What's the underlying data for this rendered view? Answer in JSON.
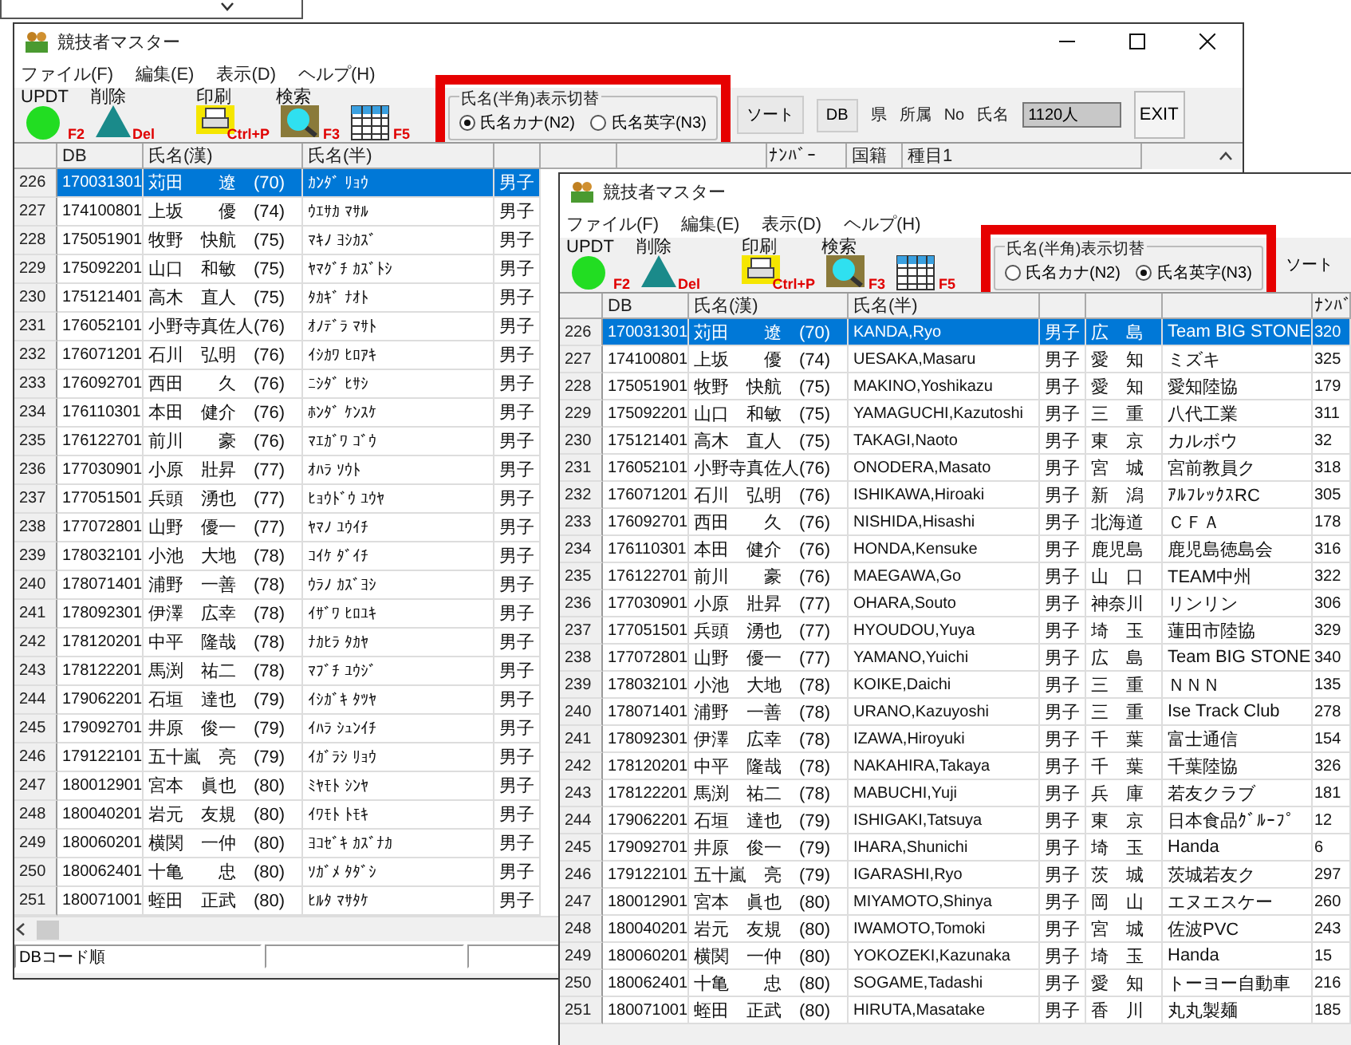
{
  "windows": [
    {
      "title": "競技者マスター",
      "window_buttons": true,
      "menu": [
        "ファイル(F)",
        "編集(E)",
        "表示(D)",
        "ヘルプ(H)"
      ],
      "tools": [
        {
          "kind": "update",
          "label": "UPDT",
          "key": "F2"
        },
        {
          "kind": "delete",
          "label": "削除",
          "key": "Del"
        },
        {
          "kind": "print",
          "label": "印刷",
          "key": "Ctrl+P"
        },
        {
          "kind": "search",
          "label": "検索",
          "key": "F3"
        },
        {
          "kind": "refresh",
          "key": "F5"
        }
      ],
      "name_display": {
        "legend": "氏名(半角)表示切替",
        "highlighted": true,
        "options": [
          {
            "label": "氏名カナ(N2)",
            "selected": true
          },
          {
            "label": "氏名英字(N3)",
            "selected": false
          }
        ]
      },
      "extras": [
        {
          "kind": "button",
          "text": "ソート"
        },
        {
          "kind": "button",
          "text": "DB"
        },
        {
          "kind": "label",
          "text": "県"
        },
        {
          "kind": "label",
          "text": "所属"
        },
        {
          "kind": "label",
          "text": "No"
        },
        {
          "kind": "label",
          "text": "氏名"
        },
        {
          "kind": "count",
          "text": "1120人"
        },
        {
          "kind": "exit",
          "text": "EXIT"
        }
      ],
      "grid": {
        "columns": [
          {
            "kind": "rowno"
          },
          {
            "kind": "db",
            "label": "DB"
          },
          {
            "kind": "kanji",
            "label": "氏名(漢)"
          },
          {
            "kind": "half",
            "label": "氏名(半)"
          },
          {
            "kind": "sex"
          },
          {
            "kind": "pref"
          },
          {
            "kind": "team"
          },
          {
            "kind": "number",
            "label": "ﾅﾝﾊﾞｰ"
          },
          {
            "kind": "nation",
            "label": "国籍"
          },
          {
            "kind": "event",
            "label": "種目1"
          }
        ],
        "rows": [
          {
            "selected": true,
            "cells": [
              "226",
              "170031301",
              "苅田　　遼　(70)",
              "ｶﾝﾀﾞ ﾘｮｳ",
              "男子"
            ]
          },
          {
            "selected": false,
            "cells": [
              "227",
              "174100801",
              "上坂　　優　(74)",
              "ｳｴｻｶ ﾏｻﾙ",
              "男子"
            ]
          },
          {
            "selected": false,
            "cells": [
              "228",
              "175051901",
              "牧野　快航　(75)",
              "ﾏｷﾉ ﾖｼｶｽﾞ",
              "男子"
            ]
          },
          {
            "selected": false,
            "cells": [
              "229",
              "175092201",
              "山口　和敏　(75)",
              "ﾔﾏｸﾞﾁ ｶｽﾞﾄｼ",
              "男子"
            ]
          },
          {
            "selected": false,
            "cells": [
              "230",
              "175121401",
              "高木　直人　(75)",
              "ﾀｶｷﾞ ﾅｵﾄ",
              "男子"
            ]
          },
          {
            "selected": false,
            "cells": [
              "231",
              "176052101",
              "小野寺真佐人(76)",
              "ｵﾉﾃﾞﾗ ﾏｻﾄ",
              "男子"
            ]
          },
          {
            "selected": false,
            "cells": [
              "232",
              "176071201",
              "石川　弘明　(76)",
              "ｲｼｶﾜ ﾋﾛｱｷ",
              "男子"
            ]
          },
          {
            "selected": false,
            "cells": [
              "233",
              "176092701",
              "西田　　久　(76)",
              "ﾆｼﾀﾞ ﾋｻｼ",
              "男子"
            ]
          },
          {
            "selected": false,
            "cells": [
              "234",
              "176110301",
              "本田　健介　(76)",
              "ﾎﾝﾀﾞ ｹﾝｽｹ",
              "男子"
            ]
          },
          {
            "selected": false,
            "cells": [
              "235",
              "176122701",
              "前川　　豪　(76)",
              "ﾏｴｶﾞﾜ ｺﾞｳ",
              "男子"
            ]
          },
          {
            "selected": false,
            "cells": [
              "236",
              "177030901",
              "小原　壯昇　(77)",
              "ｵﾊﾗ ｿｳﾄ",
              "男子"
            ]
          },
          {
            "selected": false,
            "cells": [
              "237",
              "177051501",
              "兵頭　湧也　(77)",
              "ﾋｮｳﾄﾞｳ ﾕｳﾔ",
              "男子"
            ]
          },
          {
            "selected": false,
            "cells": [
              "238",
              "177072801",
              "山野　優一　(77)",
              "ﾔﾏﾉ ﾕｳｲﾁ",
              "男子"
            ]
          },
          {
            "selected": false,
            "cells": [
              "239",
              "178032101",
              "小池　大地　(78)",
              "ｺｲｹ ﾀﾞｲﾁ",
              "男子"
            ]
          },
          {
            "selected": false,
            "cells": [
              "240",
              "178071401",
              "浦野　一善　(78)",
              "ｳﾗﾉ ｶｽﾞﾖｼ",
              "男子"
            ]
          },
          {
            "selected": false,
            "cells": [
              "241",
              "178092301",
              "伊澤　広幸　(78)",
              "ｲｻﾞﾜ ﾋﾛﾕｷ",
              "男子"
            ]
          },
          {
            "selected": false,
            "cells": [
              "242",
              "178120201",
              "中平　隆哉　(78)",
              "ﾅｶﾋﾗ ﾀｶﾔ",
              "男子"
            ]
          },
          {
            "selected": false,
            "cells": [
              "243",
              "178122201",
              "馬渕　祐二　(78)",
              "ﾏﾌﾞﾁ ﾕｳｼﾞ",
              "男子"
            ]
          },
          {
            "selected": false,
            "cells": [
              "244",
              "179062201",
              "石垣　達也　(79)",
              "ｲｼｶﾞｷ ﾀﾂﾔ",
              "男子"
            ]
          },
          {
            "selected": false,
            "cells": [
              "245",
              "179092701",
              "井原　俊一　(79)",
              "ｲﾊﾗ ｼｭﾝｲﾁ",
              "男子"
            ]
          },
          {
            "selected": false,
            "cells": [
              "246",
              "179122101",
              "五十嵐　亮　(79)",
              "ｲｶﾞﾗｼ ﾘｮｳ",
              "男子"
            ]
          },
          {
            "selected": false,
            "cells": [
              "247",
              "180012901",
              "宮本　眞也　(80)",
              "ﾐﾔﾓﾄ ｼﾝﾔ",
              "男子"
            ]
          },
          {
            "selected": false,
            "cells": [
              "248",
              "180040201",
              "岩元　友規　(80)",
              "ｲﾜﾓﾄ ﾄﾓｷ",
              "男子"
            ]
          },
          {
            "selected": false,
            "cells": [
              "249",
              "180060201",
              "横関　一仲　(80)",
              "ﾖｺｾﾞｷ ｶｽﾞﾅｶ",
              "男子"
            ]
          },
          {
            "selected": false,
            "cells": [
              "250",
              "180062401",
              "十亀　　忠　(80)",
              "ｿｶﾞﾒ ﾀﾀﾞｼ",
              "男子"
            ]
          },
          {
            "selected": false,
            "cells": [
              "251",
              "180071001",
              "蛭田　正武　(80)",
              "ﾋﾙﾀ ﾏｻﾀｹ",
              "男子"
            ]
          }
        ]
      },
      "status": [
        "DBコード順"
      ]
    },
    {
      "title": "競技者マスター",
      "menu": [
        "ファイル(F)",
        "編集(E)",
        "表示(D)",
        "ヘルプ(H)"
      ],
      "tools": [
        {
          "kind": "update",
          "label": "UPDT",
          "key": "F2"
        },
        {
          "kind": "delete",
          "label": "削除",
          "key": "Del"
        },
        {
          "kind": "print",
          "label": "印刷",
          "key": "Ctrl+P"
        },
        {
          "kind": "search",
          "label": "検索",
          "key": "F3"
        },
        {
          "kind": "refresh",
          "key": "F5"
        }
      ],
      "name_display": {
        "legend": "氏名(半角)表示切替",
        "highlighted": true,
        "options": [
          {
            "label": "氏名カナ(N2)",
            "selected": false
          },
          {
            "label": "氏名英字(N3)",
            "selected": true
          }
        ]
      },
      "extras": [
        {
          "kind": "button",
          "text": "ソート"
        }
      ],
      "grid": {
        "columns": [
          {
            "kind": "rowno"
          },
          {
            "kind": "db",
            "label": "DB"
          },
          {
            "kind": "kanji",
            "label": "氏名(漢)"
          },
          {
            "kind": "half",
            "label": "氏名(半)"
          },
          {
            "kind": "sex"
          },
          {
            "kind": "pref"
          },
          {
            "kind": "team"
          },
          {
            "kind": "number",
            "label": "ﾅﾝﾊﾞ"
          }
        ],
        "rows": [
          {
            "selected": true,
            "cells": [
              "226",
              "170031301",
              "苅田　　遼　(70)",
              "KANDA,Ryo",
              "男子",
              "広　島",
              "Team BIG STONE",
              "320"
            ]
          },
          {
            "selected": false,
            "cells": [
              "227",
              "174100801",
              "上坂　　優　(74)",
              "UESAKA,Masaru",
              "男子",
              "愛　知",
              "ミズキ",
              "325"
            ]
          },
          {
            "selected": false,
            "cells": [
              "228",
              "175051901",
              "牧野　快航　(75)",
              "MAKINO,Yoshikazu",
              "男子",
              "愛　知",
              "愛知陸協",
              "179"
            ]
          },
          {
            "selected": false,
            "cells": [
              "229",
              "175092201",
              "山口　和敏　(75)",
              "YAMAGUCHI,Kazutoshi",
              "男子",
              "三　重",
              "八代工業",
              "311"
            ]
          },
          {
            "selected": false,
            "cells": [
              "230",
              "175121401",
              "高木　直人　(75)",
              "TAKAGI,Naoto",
              "男子",
              "東　京",
              "カルボウ",
              "32"
            ]
          },
          {
            "selected": false,
            "cells": [
              "231",
              "176052101",
              "小野寺真佐人(76)",
              "ONODERA,Masato",
              "男子",
              "宮　城",
              "宮前教員ク",
              "318"
            ]
          },
          {
            "selected": false,
            "cells": [
              "232",
              "176071201",
              "石川　弘明　(76)",
              "ISHIKAWA,Hiroaki",
              "男子",
              "新　潟",
              "ｱﾙﾌﾚｯｸｽRC",
              "305"
            ]
          },
          {
            "selected": false,
            "cells": [
              "233",
              "176092701",
              "西田　　久　(76)",
              "NISHIDA,Hisashi",
              "男子",
              "北海道",
              "ＣＦＡ",
              "178"
            ]
          },
          {
            "selected": false,
            "cells": [
              "234",
              "176110301",
              "本田　健介　(76)",
              "HONDA,Kensuke",
              "男子",
              "鹿児島",
              "鹿児島徳島会",
              "316"
            ]
          },
          {
            "selected": false,
            "cells": [
              "235",
              "176122701",
              "前川　　豪　(76)",
              "MAEGAWA,Go",
              "男子",
              "山　口",
              "TEAM中州",
              "322"
            ]
          },
          {
            "selected": false,
            "cells": [
              "236",
              "177030901",
              "小原　壯昇　(77)",
              "OHARA,Souto",
              "男子",
              "神奈川",
              "リンリン",
              "306"
            ]
          },
          {
            "selected": false,
            "cells": [
              "237",
              "177051501",
              "兵頭　湧也　(77)",
              "HYOUDOU,Yuya",
              "男子",
              "埼　玉",
              "蓮田市陸協",
              "329"
            ]
          },
          {
            "selected": false,
            "cells": [
              "238",
              "177072801",
              "山野　優一　(77)",
              "YAMANO,Yuichi",
              "男子",
              "広　島",
              "Team BIG STONE",
              "340"
            ]
          },
          {
            "selected": false,
            "cells": [
              "239",
              "178032101",
              "小池　大地　(78)",
              "KOIKE,Daichi",
              "男子",
              "三　重",
              "ＮＮＮ",
              "135"
            ]
          },
          {
            "selected": false,
            "cells": [
              "240",
              "178071401",
              "浦野　一善　(78)",
              "URANO,Kazuyoshi",
              "男子",
              "三　重",
              "Ise Track Club",
              "278"
            ]
          },
          {
            "selected": false,
            "cells": [
              "241",
              "178092301",
              "伊澤　広幸　(78)",
              "IZAWA,Hiroyuki",
              "男子",
              "千　葉",
              "富士通信",
              "154"
            ]
          },
          {
            "selected": false,
            "cells": [
              "242",
              "178120201",
              "中平　隆哉　(78)",
              "NAKAHIRA,Takaya",
              "男子",
              "千　葉",
              "千葉陸協",
              "326"
            ]
          },
          {
            "selected": false,
            "cells": [
              "243",
              "178122201",
              "馬渕　祐二　(78)",
              "MABUCHI,Yuji",
              "男子",
              "兵　庫",
              "若友クラブ",
              "181"
            ]
          },
          {
            "selected": false,
            "cells": [
              "244",
              "179062201",
              "石垣　達也　(79)",
              "ISHIGAKI,Tatsuya",
              "男子",
              "東　京",
              "日本食品ｸﾞﾙｰﾌﾟ",
              "12"
            ]
          },
          {
            "selected": false,
            "cells": [
              "245",
              "179092701",
              "井原　俊一　(79)",
              "IHARA,Shunichi",
              "男子",
              "埼　玉",
              "Handa",
              "6"
            ]
          },
          {
            "selected": false,
            "cells": [
              "246",
              "179122101",
              "五十嵐　亮　(79)",
              "IGARASHI,Ryo",
              "男子",
              "茨　城",
              "茨城若友ク",
              "297"
            ]
          },
          {
            "selected": false,
            "cells": [
              "247",
              "180012901",
              "宮本　眞也　(80)",
              "MIYAMOTO,Shinya",
              "男子",
              "岡　山",
              "エヌエスケー",
              "260"
            ]
          },
          {
            "selected": false,
            "cells": [
              "248",
              "180040201",
              "岩元　友規　(80)",
              "IWAMOTO,Tomoki",
              "男子",
              "宮　城",
              "佐波PVC",
              "243"
            ]
          },
          {
            "selected": false,
            "cells": [
              "249",
              "180060201",
              "横関　一仲　(80)",
              "YOKOZEKI,Kazunaka",
              "男子",
              "埼　玉",
              "Handa",
              "15"
            ]
          },
          {
            "selected": false,
            "cells": [
              "250",
              "180062401",
              "十亀　　忠　(80)",
              "SOGAME,Tadashi",
              "男子",
              "愛　知",
              "トーヨー自動車",
              "216"
            ]
          },
          {
            "selected": false,
            "cells": [
              "251",
              "180071001",
              "蛭田　正武　(80)",
              "HIRUTA,Masatake",
              "男子",
              "香　川",
              "丸丸製麺",
              "185"
            ]
          }
        ]
      }
    }
  ]
}
